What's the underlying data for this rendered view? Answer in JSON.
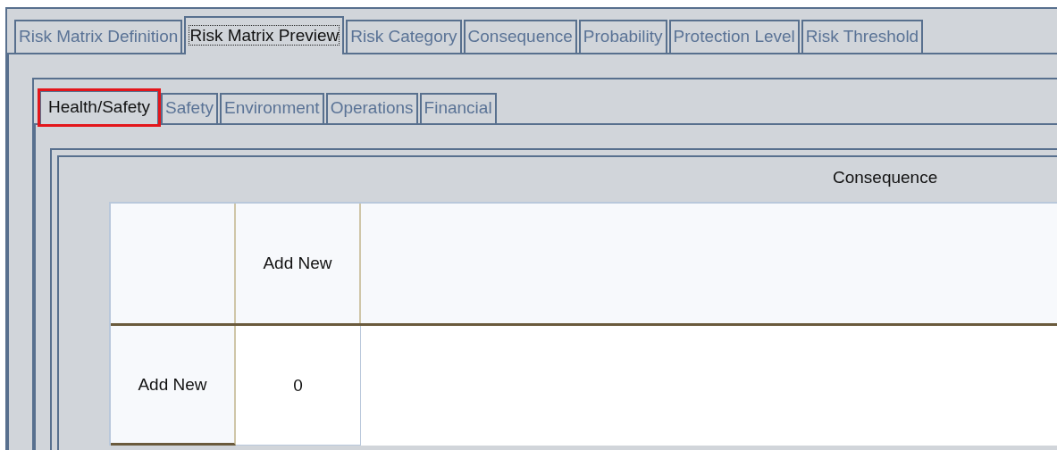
{
  "main_tabs": [
    {
      "label": "Risk Matrix Definition",
      "selected": false
    },
    {
      "label": "Risk Matrix Preview",
      "selected": true
    },
    {
      "label": "Risk Category",
      "selected": false
    },
    {
      "label": "Consequence",
      "selected": false
    },
    {
      "label": "Probability",
      "selected": false
    },
    {
      "label": "Protection Level",
      "selected": false
    },
    {
      "label": "Risk Threshold",
      "selected": false
    }
  ],
  "category_tabs": [
    {
      "label": "Health/Safety",
      "selected": true,
      "highlighted": true
    },
    {
      "label": "Safety",
      "selected": false,
      "highlighted": false
    },
    {
      "label": "Environment",
      "selected": false,
      "highlighted": false
    },
    {
      "label": "Operations",
      "selected": false,
      "highlighted": false
    },
    {
      "label": "Financial",
      "selected": false,
      "highlighted": false
    }
  ],
  "matrix": {
    "axis_label": "Consequence",
    "header_row": [
      "Add New"
    ],
    "rows": [
      {
        "label": "Add New",
        "cells": [
          "0"
        ]
      }
    ]
  }
}
